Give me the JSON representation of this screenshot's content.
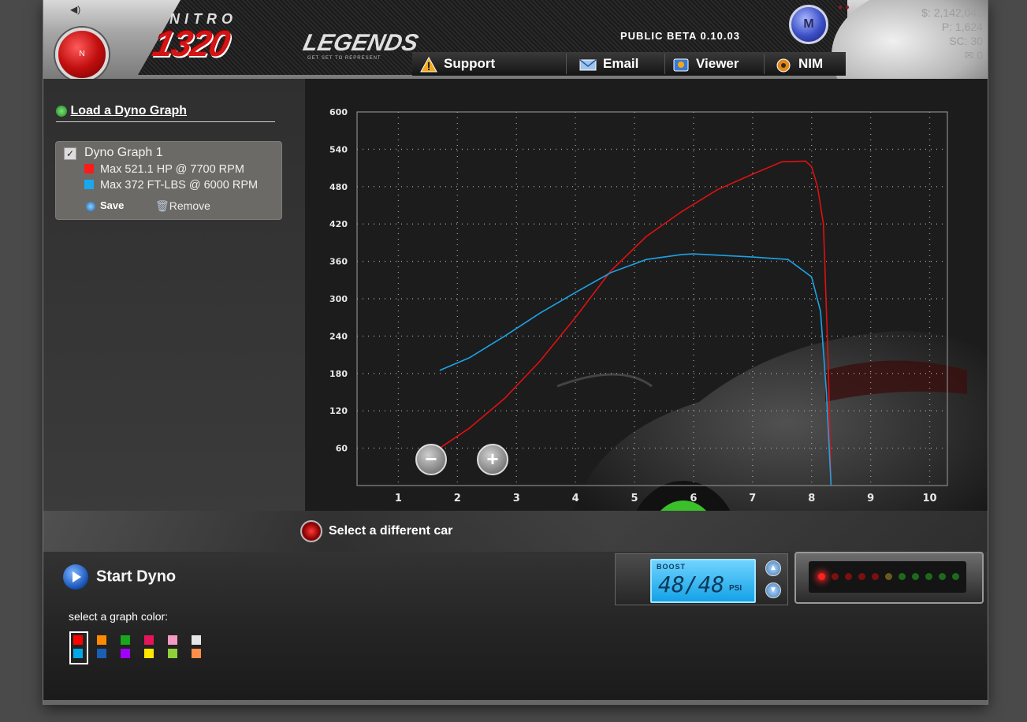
{
  "header": {
    "logo": {
      "brand": "NITRO",
      "title": "1320",
      "subtitle": "LEGENDS",
      "tagline": "GET SET TO REPRESENT"
    },
    "version": "PUBLIC BETA 0.10.03",
    "nav": [
      {
        "label": "Support",
        "icon": "warning-icon"
      },
      {
        "label": "Email",
        "icon": "envelope-icon"
      },
      {
        "label": "Viewer",
        "icon": "viewer-icon"
      },
      {
        "label": "NIM",
        "icon": "nim-icon"
      }
    ],
    "m_button": "M",
    "nitro_button": "N",
    "stats": {
      "money": "$: 2,142,043",
      "points": "P: 1,624",
      "sc": "SC: 30",
      "messages": "0"
    }
  },
  "left_panel": {
    "load_link": "Load a Dyno Graph",
    "graph": {
      "name": "Dyno Graph 1",
      "checked": true,
      "hp_label": "Max 521.1 HP @ 7700 RPM",
      "tq_label": "Max 372 FT-LBS @ 6000 RPM",
      "hp_color": "#ff1a1a",
      "tq_color": "#19a7ee",
      "save": "Save",
      "remove": "Remove"
    }
  },
  "chart_data": {
    "type": "line",
    "x_ticks": [
      "1",
      "2",
      "3",
      "4",
      "5",
      "6",
      "7",
      "8",
      "9",
      "10"
    ],
    "y_ticks": [
      "600",
      "540",
      "480",
      "420",
      "360",
      "300",
      "240",
      "180",
      "120",
      "60"
    ],
    "xlim": [
      0.3,
      10.3
    ],
    "ylim": [
      0,
      600
    ],
    "grid": true,
    "series": [
      {
        "color": "#e01010",
        "points": [
          [
            1.7,
            60
          ],
          [
            2.2,
            92
          ],
          [
            2.8,
            140
          ],
          [
            3.4,
            200
          ],
          [
            4.0,
            270
          ],
          [
            4.6,
            345
          ],
          [
            5.2,
            400
          ],
          [
            5.8,
            440
          ],
          [
            6.4,
            475
          ],
          [
            7.0,
            500
          ],
          [
            7.5,
            520
          ],
          [
            7.9,
            521
          ],
          [
            8.0,
            512
          ],
          [
            8.1,
            480
          ],
          [
            8.2,
            420
          ],
          [
            8.28,
            200
          ],
          [
            8.33,
            0
          ]
        ]
      },
      {
        "color": "#1ca3e6",
        "points": [
          [
            1.7,
            185
          ],
          [
            2.2,
            205
          ],
          [
            2.8,
            240
          ],
          [
            3.4,
            277
          ],
          [
            4.0,
            310
          ],
          [
            4.6,
            342
          ],
          [
            5.2,
            363
          ],
          [
            5.8,
            371
          ],
          [
            6.0,
            372
          ],
          [
            6.4,
            370
          ],
          [
            7.0,
            367
          ],
          [
            7.6,
            363
          ],
          [
            8.0,
            335
          ],
          [
            8.15,
            280
          ],
          [
            8.25,
            150
          ],
          [
            8.33,
            0
          ]
        ]
      }
    ]
  },
  "bottom": {
    "select_car": "Select a different car",
    "start_dyno": "Start Dyno",
    "color_prompt": "select a graph color:",
    "palette": [
      [
        "#ff0000",
        "#00a8e8"
      ],
      [
        "#ff8a00",
        "#1a5fb4"
      ],
      [
        "#18a81a",
        "#a100ff"
      ],
      [
        "#e8145a",
        "#ffe600"
      ],
      [
        "#f39ac2",
        "#8fcf3a"
      ],
      [
        "#e6e6e6",
        "#ff8f4a"
      ]
    ],
    "boost": {
      "label": "BOOST",
      "value": "48/48",
      "unit": "PSI"
    },
    "shift_leds": [
      "#ff2020",
      "#7a1010",
      "#7a1010",
      "#7a1010",
      "#7a1010",
      "#6a5a1a",
      "#1d6a1d",
      "#1d6a1d",
      "#1d6a1d",
      "#1d6a1d",
      "#1d6a1d"
    ]
  }
}
